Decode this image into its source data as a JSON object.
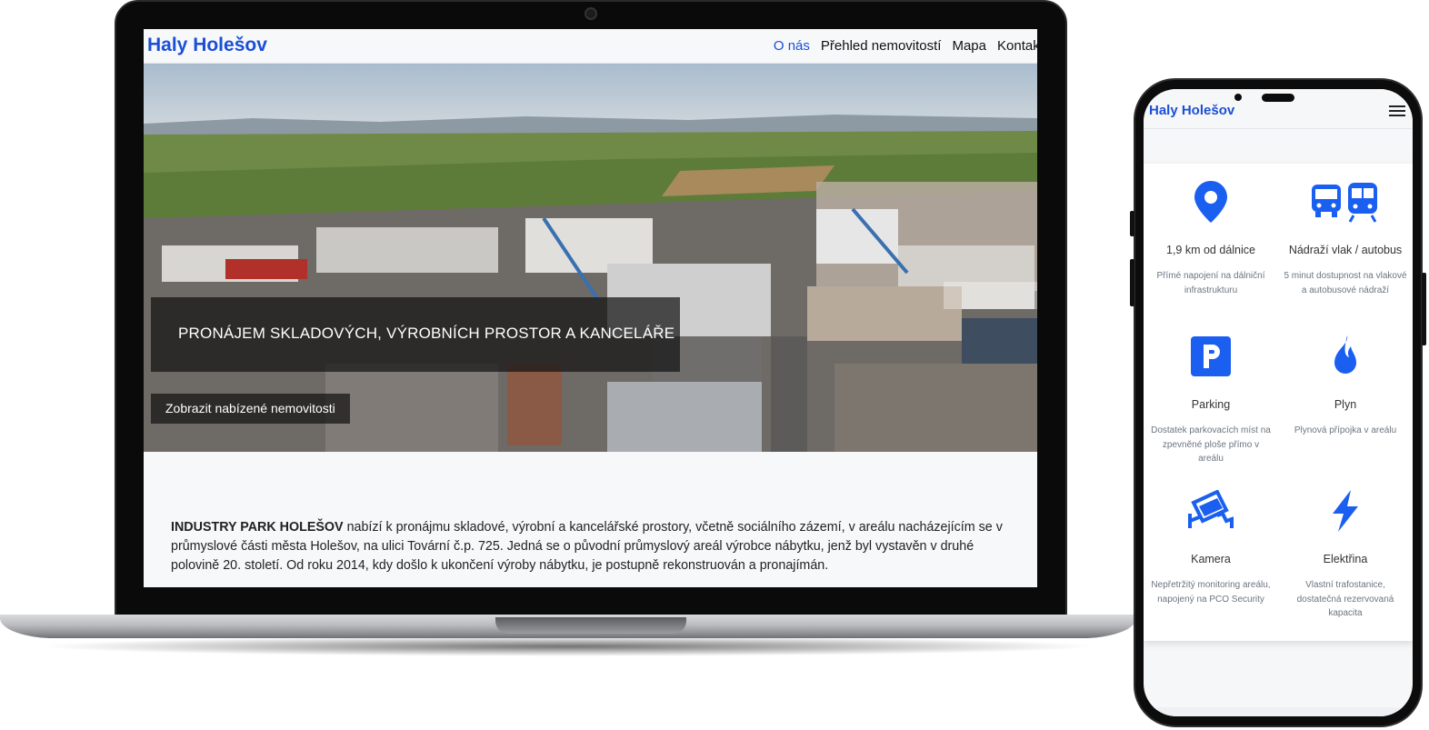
{
  "laptop": {
    "brand": "Haly Holešov",
    "nav": [
      "O nás",
      "Přehled nemovitostí",
      "Mapa",
      "Kontakt"
    ],
    "hero_title": "PRONÁJEM SKLADOVÝCH, VÝROBNÍCH PROSTOR A KANCELÁŘE",
    "hero_button": "Zobrazit nabízené nemovitosti",
    "intro_bold": "INDUSTRY PARK HOLEŠOV",
    "intro_text": " nabízí k pronájmu skladové, výrobní a kancelářské prostory, včetně sociálního zázemí, v areálu nacházejícím se v průmyslové části města Holešov, na ulici Tovární č.p. 725. Jedná se o původní průmyslový areál výrobce nábytku, jenž byl vystavěn v druhé polovině 20. století. Od roku 2014, kdy došlo k ukončení výroby nábytku, je postupně rekonstruován a pronajímán."
  },
  "phone": {
    "brand": "Haly Holešov",
    "features": [
      {
        "icon": "location-pin-icon",
        "title": "1,9 km od dálnice",
        "desc": "Přímé napojení na dálniční infrastrukturu"
      },
      {
        "icon": "bus-train-icon",
        "title": "Nádraží vlak / autobus",
        "desc": "5 minut dostupnost na vlakové a autobusové nádraží"
      },
      {
        "icon": "parking-icon",
        "title": "Parking",
        "desc": "Dostatek parkovacích míst na zpevněné ploše přímo v areálu"
      },
      {
        "icon": "gas-flame-icon",
        "title": "Plyn",
        "desc": "Plynová přípojka v areálu"
      },
      {
        "icon": "camera-icon",
        "title": "Kamera",
        "desc": "Nepřetržitý monitoring areálu, napojený na PCO Security"
      },
      {
        "icon": "lightning-icon",
        "title": "Elektřina",
        "desc": "Vlastní trafostanice, dostatečná rezervovaná kapacita"
      }
    ]
  },
  "colors": {
    "brand": "#1a4fd6",
    "icon_blue": "#1a5ff0",
    "overlay": "rgba(20,20,20,0.72)"
  }
}
